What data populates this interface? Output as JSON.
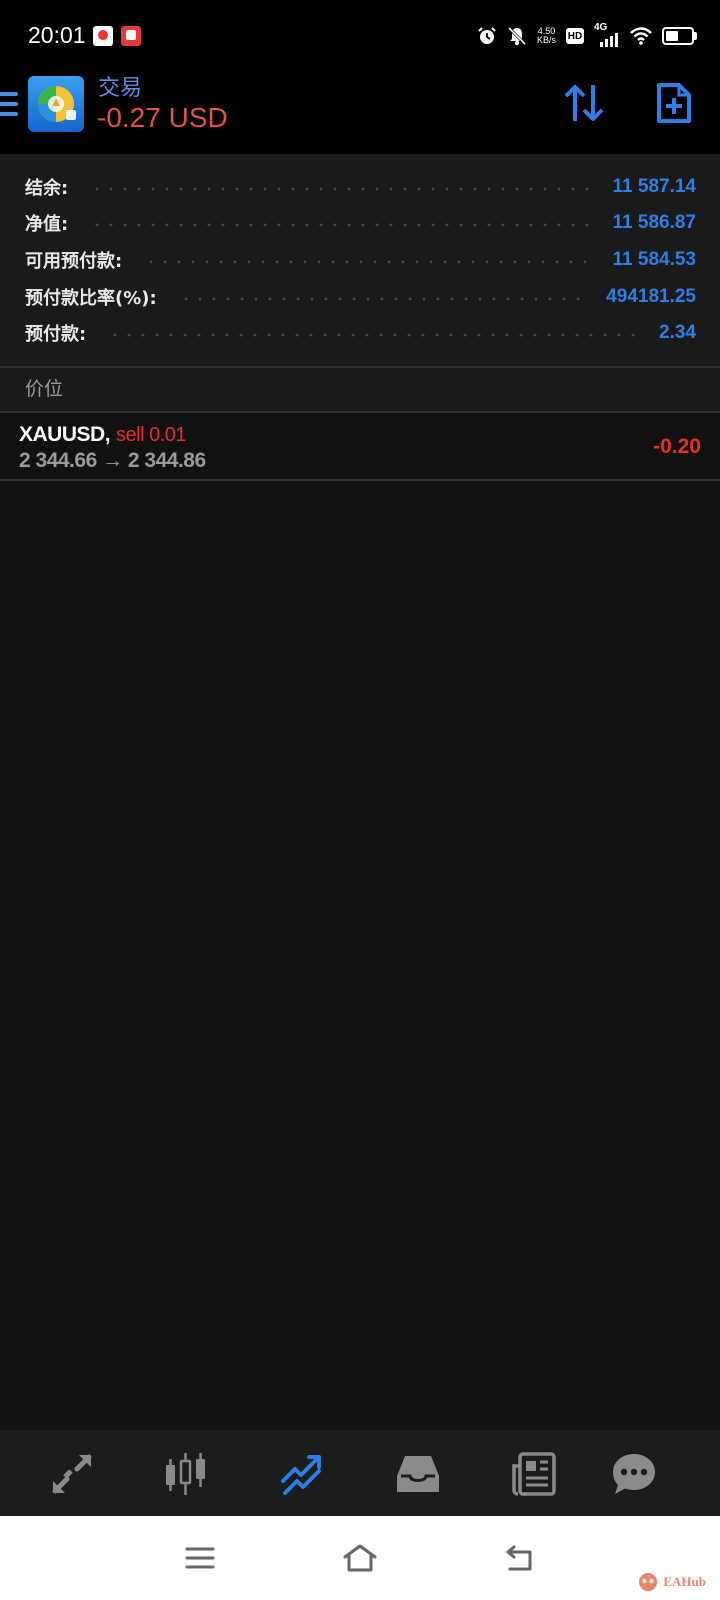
{
  "status_bar": {
    "time": "20:01",
    "net_speed_value": "4.50",
    "net_speed_unit": "KB/s",
    "hd_label": "HD",
    "signal_label": "4G"
  },
  "header": {
    "title": "交易",
    "profit": "-0.27 USD"
  },
  "summary": {
    "rows": [
      {
        "label": "结余:",
        "value": "11 587.14"
      },
      {
        "label": "净值:",
        "value": "11 586.87"
      },
      {
        "label": "可用预付款:",
        "value": "11 584.53"
      },
      {
        "label": "预付款比率(%):",
        "value": "494181.25"
      },
      {
        "label": "预付款:",
        "value": "2.34"
      }
    ]
  },
  "section": {
    "title": "价位"
  },
  "positions": [
    {
      "symbol": "XAUUSD",
      "separator": ",",
      "type": "sell 0.01",
      "prices": "2 344.66 → 2 344.86",
      "profit": "-0.20"
    }
  ],
  "tabs": [
    {
      "icon": "quotes-icon"
    },
    {
      "icon": "chart-icon"
    },
    {
      "icon": "trade-icon",
      "active": true
    },
    {
      "icon": "history-icon"
    },
    {
      "icon": "news-icon"
    },
    {
      "icon": "messages-icon"
    }
  ],
  "colors": {
    "accent": "#2e7fe6",
    "loss": "#e0302b",
    "header_loss": "#e0524b",
    "tab_inactive": "#8a8a8a",
    "tab_active": "#2e7fe6"
  },
  "watermark": {
    "text": "EAHub"
  }
}
